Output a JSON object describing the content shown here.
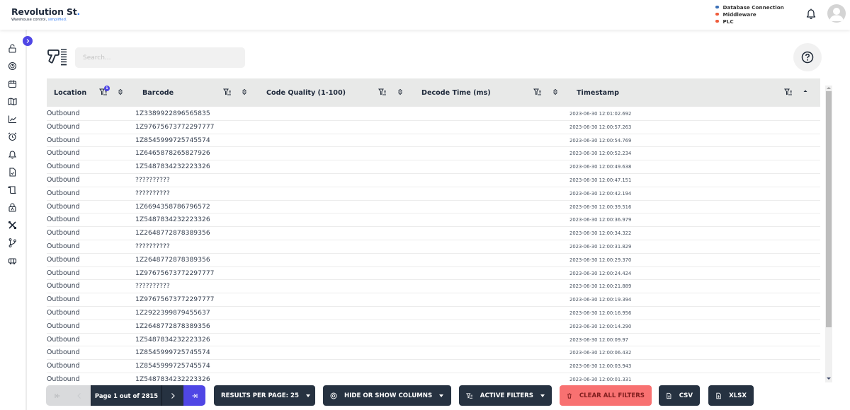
{
  "header": {
    "brand_name": "Revolution St",
    "brand_dot": ".",
    "tagline_prefix": "Warehouse control, ",
    "tagline_accent": "simplified.",
    "status": [
      {
        "label": "Database Connection",
        "color": "#3b6fb6"
      },
      {
        "label": "Middleware",
        "color": "#ef5b3a"
      },
      {
        "label": "PLC",
        "color": "#ef5b3a"
      }
    ],
    "notification_icon": "bell-icon",
    "avatar_icon": "user-avatar-icon"
  },
  "sidebar": {
    "toggle_icon": "chevron-right-icon",
    "items": [
      {
        "icon": "unlock-icon"
      },
      {
        "icon": "speedometer-icon"
      },
      {
        "icon": "package-icon"
      },
      {
        "icon": "map-icon"
      },
      {
        "icon": "chart-line-icon"
      },
      {
        "icon": "alarm-clock-icon"
      },
      {
        "icon": "bell-icon"
      },
      {
        "icon": "file-report-icon"
      },
      {
        "icon": "scroll-icon"
      },
      {
        "icon": "lock-icon"
      },
      {
        "icon": "tools-icon"
      },
      {
        "icon": "git-branch-icon"
      },
      {
        "icon": "forklift-icon"
      }
    ]
  },
  "toolbar": {
    "scanner_icon": "barcode-scanner-icon",
    "search_placeholder": "Search...",
    "search_value": "",
    "help_icon": "help-circle-icon"
  },
  "table": {
    "columns": [
      {
        "label": "Location",
        "filter_count": "1",
        "sort": "none"
      },
      {
        "label": "Barcode",
        "sort": "none"
      },
      {
        "label": "Code Quality (1-100)",
        "sort": "none"
      },
      {
        "label": "Decode Time (ms)",
        "sort": "none"
      },
      {
        "label": "Timestamp",
        "sort": "ascending"
      }
    ],
    "rows": [
      {
        "location": "Outbound",
        "barcode": "1Z3389922896565835",
        "quality": "",
        "decode": "",
        "timestamp": "2023-06-30 12:01:02.692"
      },
      {
        "location": "Outbound",
        "barcode": "1Z97675673772297777",
        "quality": "",
        "decode": "",
        "timestamp": "2023-06-30 12:00:57.263"
      },
      {
        "location": "Outbound",
        "barcode": "1Z8545999725745574",
        "quality": "",
        "decode": "",
        "timestamp": "2023-06-30 12:00:54.769"
      },
      {
        "location": "Outbound",
        "barcode": "1Z6465878265827926",
        "quality": "",
        "decode": "",
        "timestamp": "2023-06-30 12:00:52.234"
      },
      {
        "location": "Outbound",
        "barcode": "1Z5487834232223326",
        "quality": "",
        "decode": "",
        "timestamp": "2023-06-30 12:00:49.638"
      },
      {
        "location": "Outbound",
        "barcode": "??????????",
        "quality": "",
        "decode": "",
        "timestamp": "2023-06-30 12:00:47.151"
      },
      {
        "location": "Outbound",
        "barcode": "??????????",
        "quality": "",
        "decode": "",
        "timestamp": "2023-06-30 12:00:42.194"
      },
      {
        "location": "Outbound",
        "barcode": "1Z6694358786796572",
        "quality": "",
        "decode": "",
        "timestamp": "2023-06-30 12:00:39.516"
      },
      {
        "location": "Outbound",
        "barcode": "1Z5487834232223326",
        "quality": "",
        "decode": "",
        "timestamp": "2023-06-30 12:00:36.979"
      },
      {
        "location": "Outbound",
        "barcode": "1Z2648772878389356",
        "quality": "",
        "decode": "",
        "timestamp": "2023-06-30 12:00:34.322"
      },
      {
        "location": "Outbound",
        "barcode": "??????????",
        "quality": "",
        "decode": "",
        "timestamp": "2023-06-30 12:00:31.829"
      },
      {
        "location": "Outbound",
        "barcode": "1Z2648772878389356",
        "quality": "",
        "decode": "",
        "timestamp": "2023-06-30 12:00:29.370"
      },
      {
        "location": "Outbound",
        "barcode": "1Z97675673772297777",
        "quality": "",
        "decode": "",
        "timestamp": "2023-06-30 12:00:24.424"
      },
      {
        "location": "Outbound",
        "barcode": "??????????",
        "quality": "",
        "decode": "",
        "timestamp": "2023-06-30 12:00:21.889"
      },
      {
        "location": "Outbound",
        "barcode": "1Z97675673772297777",
        "quality": "",
        "decode": "",
        "timestamp": "2023-06-30 12:00:19.394"
      },
      {
        "location": "Outbound",
        "barcode": "1Z2922399879455637",
        "quality": "",
        "decode": "",
        "timestamp": "2023-06-30 12:00:16.956"
      },
      {
        "location": "Outbound",
        "barcode": "1Z2648772878389356",
        "quality": "",
        "decode": "",
        "timestamp": "2023-06-30 12:00:14.290"
      },
      {
        "location": "Outbound",
        "barcode": "1Z5487834232223326",
        "quality": "",
        "decode": "",
        "timestamp": "2023-06-30 12:00:09.97"
      },
      {
        "location": "Outbound",
        "barcode": "1Z8545999725745574",
        "quality": "",
        "decode": "",
        "timestamp": "2023-06-30 12:00:06.432"
      },
      {
        "location": "Outbound",
        "barcode": "1Z8545999725745574",
        "quality": "",
        "decode": "",
        "timestamp": "2023-06-30 12:00:03.943"
      },
      {
        "location": "Outbound",
        "barcode": "1Z5487834232223326",
        "quality": "",
        "decode": "",
        "timestamp": "2023-06-30 12:00:01.331"
      }
    ]
  },
  "pagination": {
    "label": "Page 1 out of 2815",
    "current_page": 1,
    "total_pages": 2815
  },
  "actions": {
    "results_per_page": "RESULTS PER PAGE: 25",
    "hide_show_columns": "HIDE OR SHOW COLUMNS",
    "active_filters": "ACTIVE FILTERS",
    "clear_all_filters": "CLEAR ALL FILTERS",
    "csv": "CSV",
    "xlsx": "XLSX"
  },
  "colors": {
    "accent": "#4f46e5",
    "dark_button": "#263241",
    "danger_button": "#f87171",
    "header_bg": "#e8e9e8"
  }
}
